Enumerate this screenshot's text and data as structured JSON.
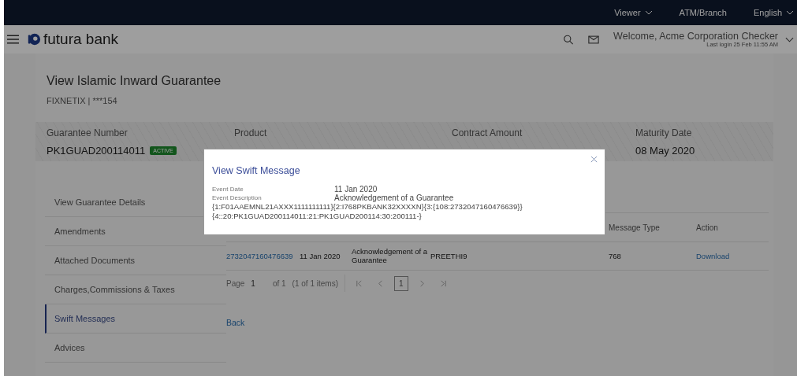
{
  "top_bar": {
    "items": [
      {
        "label": "Viewer",
        "dropdown": true
      },
      {
        "label": "ATM/Branch",
        "dropdown": false
      },
      {
        "label": "English",
        "dropdown": true
      }
    ]
  },
  "header": {
    "logo": "futura bank",
    "welcome": "Welcome, Acme Corporation Checker",
    "last_login": "Last login 25 Feb 11:55 AM"
  },
  "page": {
    "title": "View Islamic Inward Guarantee",
    "subtitle": "FIXNETIX | ***154"
  },
  "summary": [
    {
      "label": "Guarantee Number",
      "value": "PK1GUAD200114011",
      "badge": "ACTIVE"
    },
    {
      "label": "Product"
    },
    {
      "label": "Contract Amount"
    },
    {
      "label": "Maturity Date",
      "value": "08 May 2020"
    }
  ],
  "sidebar": {
    "items": [
      {
        "label": "View Guarantee Details",
        "selected": false
      },
      {
        "label": "Amendments",
        "selected": false
      },
      {
        "label": "Attached Documents",
        "selected": false
      },
      {
        "label": "Charges,Commissions & Taxes",
        "selected": false
      },
      {
        "label": "Swift Messages",
        "selected": true
      },
      {
        "label": "Advices",
        "selected": false
      }
    ]
  },
  "table": {
    "columns": [
      "Message Type",
      "Action"
    ],
    "rows": [
      {
        "reference": "2732047160476639",
        "date": "11 Jan 2020",
        "description": "Acknowledgement of a Guarantee",
        "user": "PREETHI9",
        "message_type": "768",
        "action": "Download"
      }
    ]
  },
  "pagination": {
    "page_label": "Page",
    "page": "1",
    "of": "of 1",
    "items": "(1 of 1 items)",
    "current": "1"
  },
  "back": "Back",
  "modal": {
    "title": "View Swift Message",
    "fields": [
      {
        "label": "Event Date",
        "value": "11 Jan 2020"
      },
      {
        "label": "Event Description",
        "value": "Acknowledgement of a Guarantee"
      }
    ],
    "message": [
      "{1:F01AAEMNL21AXXX1111111111}{2:I768PKBANK32XXXXN}{3:{108:2732047160476639}}",
      "{4::20:PK1GUAD200114011:21:PK1GUAD200114:30:200111-}"
    ]
  }
}
